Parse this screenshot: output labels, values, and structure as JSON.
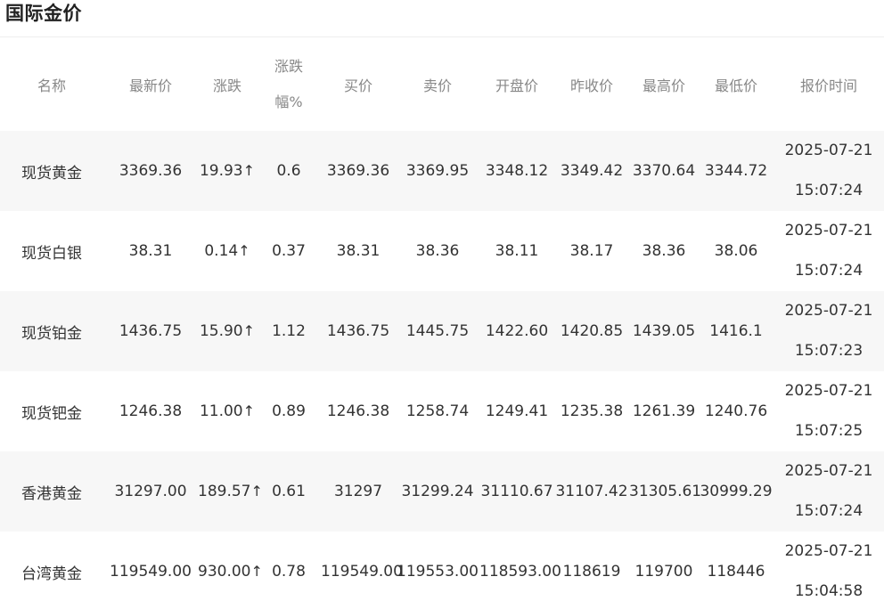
{
  "page": {
    "title": "国际金价"
  },
  "table": {
    "headers": {
      "name": "名称",
      "latest": "最新价",
      "change": "涨跌",
      "pct_line1": "涨跌",
      "pct_line2": "幅%",
      "bid": "买价",
      "ask": "卖价",
      "open": "开盘价",
      "prev_close": "昨收价",
      "high": "最高价",
      "low": "最低价",
      "time": "报价时间"
    },
    "up_arrow": "↑",
    "colors": {
      "up_red": "#e60012",
      "name_blue": "#365899",
      "header_gray": "#888888",
      "row_shade": "#f7f7f7"
    },
    "rows": [
      {
        "name": "现货黄金",
        "latest": "3369.36",
        "change": "19.93",
        "pct": "0.6",
        "bid": "3369.36",
        "ask": "3369.95",
        "open": "3348.12",
        "prev_close": "3349.42",
        "high": "3370.64",
        "low": "3344.72",
        "date": "2025-07-21",
        "time": "15:07:24"
      },
      {
        "name": "现货白银",
        "latest": "38.31",
        "change": "0.14",
        "pct": "0.37",
        "bid": "38.31",
        "ask": "38.36",
        "open": "38.11",
        "prev_close": "38.17",
        "high": "38.36",
        "low": "38.06",
        "date": "2025-07-21",
        "time": "15:07:24"
      },
      {
        "name": "现货铂金",
        "latest": "1436.75",
        "change": "15.90",
        "pct": "1.12",
        "bid": "1436.75",
        "ask": "1445.75",
        "open": "1422.60",
        "prev_close": "1420.85",
        "high": "1439.05",
        "low": "1416.1",
        "date": "2025-07-21",
        "time": "15:07:23"
      },
      {
        "name": "现货钯金",
        "latest": "1246.38",
        "change": "11.00",
        "pct": "0.89",
        "bid": "1246.38",
        "ask": "1258.74",
        "open": "1249.41",
        "prev_close": "1235.38",
        "high": "1261.39",
        "low": "1240.76",
        "date": "2025-07-21",
        "time": "15:07:25"
      },
      {
        "name": "香港黄金",
        "latest": "31297.00",
        "change": "189.57",
        "pct": "0.61",
        "bid": "31297",
        "ask": "31299.24",
        "open": "31110.67",
        "prev_close": "31107.42",
        "high": "31305.61",
        "low": "30999.29",
        "date": "2025-07-21",
        "time": "15:07:24"
      },
      {
        "name": "台湾黄金",
        "latest": "119549.00",
        "change": "930.00",
        "pct": "0.78",
        "bid": "119549.00",
        "ask": "119553.00",
        "open": "118593.00",
        "prev_close": "118619",
        "high": "119700",
        "low": "118446",
        "date": "2025-07-21",
        "time": "15:04:58"
      }
    ]
  }
}
